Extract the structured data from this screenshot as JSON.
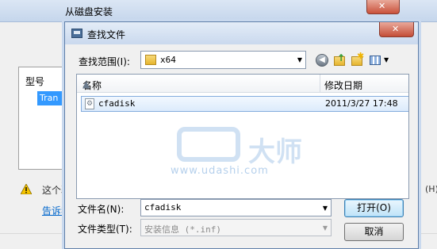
{
  "background_window": {
    "title": "从磁盘安装",
    "column_label": "型号",
    "selected_item": "Tran",
    "warning_text": "这个驱",
    "link_text": "告诉我",
    "right_edge_text": "(H)"
  },
  "dialog": {
    "title": "查找文件",
    "close_label": "✕",
    "lookin_label": "查找范围(I):",
    "lookin_value": "x64",
    "columns": {
      "name": "名称",
      "modified": "修改日期"
    },
    "files": [
      {
        "name": "cfadisk",
        "modified": "2011/3/27 17:48"
      }
    ],
    "filename_label": "文件名(N):",
    "filename_value": "cfadisk",
    "filetype_label": "文件类型(T):",
    "filetype_value": "安装信息 (*.inf)",
    "open_button": "打开(O)",
    "cancel_button": "取消"
  },
  "watermark": {
    "brand": "大师",
    "url": "www.udashi.com"
  },
  "icons": {
    "folder": "folder-icon",
    "back": "back-arrow-icon",
    "up": "up-folder-icon",
    "new_folder": "new-folder-icon",
    "view": "view-menu-icon",
    "file": "setup-file-icon",
    "warning": "warning-icon"
  }
}
